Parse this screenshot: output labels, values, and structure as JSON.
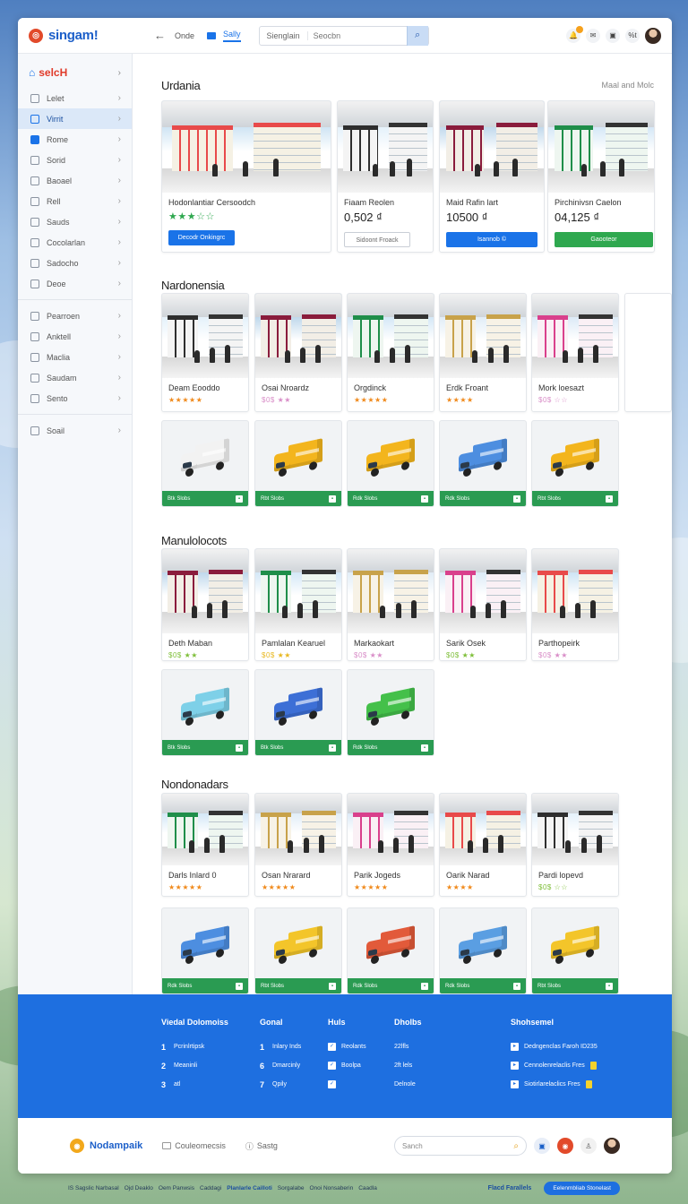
{
  "app": {
    "logo_text": "singam!"
  },
  "header": {
    "nav": [
      "Onde",
      "Sally",
      "Sienglain"
    ],
    "search_placeholder": "Seocbn",
    "icons": [
      "bell-icon",
      "chat-icon",
      "message-icon",
      "user-icon"
    ],
    "user_short": "%t"
  },
  "sidebar": {
    "head": "selcH",
    "items": [
      {
        "label": "Lelet",
        "icon": "document-icon"
      },
      {
        "label": "Virrit",
        "icon": "search-icon",
        "active": true
      },
      {
        "label": "Rome",
        "icon": "screen-icon"
      },
      {
        "label": "Sorid",
        "icon": "grid-icon"
      },
      {
        "label": "Baoael",
        "icon": "bag-icon"
      },
      {
        "label": "Rell",
        "icon": "folder-icon"
      },
      {
        "label": "Sauds",
        "icon": "table-icon"
      },
      {
        "label": "Cocolarlan",
        "icon": "clipboard-icon"
      },
      {
        "label": "Sadocho",
        "icon": "pin-icon"
      },
      {
        "label": "Deoe",
        "icon": "box-icon"
      }
    ],
    "items2": [
      {
        "label": "Pearroen",
        "icon": "settings-icon"
      },
      {
        "label": "Anktell",
        "icon": "square-icon"
      },
      {
        "label": "Maclia",
        "icon": "gear-icon"
      },
      {
        "label": "Saudam",
        "icon": "bag-icon"
      },
      {
        "label": "Sento",
        "icon": "square-icon"
      }
    ],
    "items3": [
      {
        "label": "Soail",
        "icon": "briefcase-icon"
      }
    ]
  },
  "sections": [
    {
      "title": "Urdania",
      "more": "Maal and Molc",
      "featured": [
        {
          "title": "Hodonlantiar Cersoodch",
          "stars": "★★★☆☆",
          "button": "Decodr Onkingrc",
          "button_style": "blue"
        },
        {
          "title": "Fiaam Reolen",
          "price": "0,502 ₫",
          "button": "Sidoont Froack",
          "button_style": "outline"
        },
        {
          "title": "Maid Rafin lart",
          "price": "10500 ₫",
          "button": "Isannob ©",
          "button_style": "blue-wide"
        },
        {
          "title": "Pirchinivsn Caelon",
          "price": "04,125 ₫",
          "button": "Gaooteor",
          "button_style": "green"
        }
      ]
    },
    {
      "title": "Nardonensia",
      "stores": [
        {
          "title": "Deam Eooddo",
          "stars": "★★★★★",
          "star_color": "#f08a1c"
        },
        {
          "title": "Osai Nroardz",
          "stars": "$0$ ★★",
          "star_color": "#d98ec8"
        },
        {
          "title": "Orgdinck",
          "stars": "★★★★★",
          "star_color": "#f08a1c"
        },
        {
          "title": "Erdk Froant",
          "stars": "★★★★",
          "star_color": "#f08a1c"
        },
        {
          "title": "Mork loesazt",
          "stars": "$0$ ☆☆",
          "star_color": "#d98ec8"
        }
      ],
      "trucks": [
        {
          "label": "Btk Slobs",
          "color": "#f2f2f2"
        },
        {
          "label": "Rbt Slobs",
          "color": "#f3b51d"
        },
        {
          "label": "Rdk Slobs",
          "color": "#f3b51d"
        },
        {
          "label": "Rdk Slobs",
          "color": "#4d8ee0"
        },
        {
          "label": "Rbt Slobs",
          "color": "#f3b51d"
        }
      ]
    },
    {
      "title": "Manulolocots",
      "stores": [
        {
          "title": "Deth Maban",
          "stars": "$0$ ★★",
          "star_color": "#7fbf3a"
        },
        {
          "title": "Pamlalan Kearuel",
          "stars": "$0$ ★★",
          "star_color": "#e8b820"
        },
        {
          "title": "Markaokart",
          "stars": "$0$ ★★",
          "star_color": "#d98ec8"
        },
        {
          "title": "Sarik Osek",
          "stars": "$0$ ★★",
          "star_color": "#7fbf3a"
        },
        {
          "title": "Parthopeirk",
          "stars": "$0$ ★★",
          "star_color": "#d98ec8"
        }
      ],
      "trucks": [
        {
          "label": "Btk Slobs",
          "color": "#7ed0e8"
        },
        {
          "label": "Btk Slobs",
          "color": "#3d6fd6"
        },
        {
          "label": "Rdk Slobs",
          "color": "#44c04a"
        }
      ]
    },
    {
      "title": "Nondonadars",
      "stores": [
        {
          "title": "Darls Inlard 0",
          "stars": "★★★★★",
          "star_color": "#f08a1c"
        },
        {
          "title": "Osan Nrarard",
          "stars": "★★★★★",
          "star_color": "#f08a1c"
        },
        {
          "title": "Parik Jogeds",
          "stars": "★★★★★",
          "star_color": "#f08a1c"
        },
        {
          "title": "Oarik Narad",
          "stars": "★★★★",
          "star_color": "#f08a1c"
        },
        {
          "title": "Pardi lopevd",
          "stars": "$0$ ☆☆",
          "star_color": "#7fbf3a"
        }
      ],
      "trucks": [
        {
          "label": "Rdk Slobs",
          "color": "#4d8ee0"
        },
        {
          "label": "Rbt Slobs",
          "color": "#f3c52a"
        },
        {
          "label": "Rdk Slobs",
          "color": "#e25a3a"
        },
        {
          "label": "Rdk Slobs",
          "color": "#5a9ee2"
        },
        {
          "label": "Rbt Slobs",
          "color": "#f3c52a"
        }
      ]
    }
  ],
  "footer": {
    "cols": [
      {
        "head": "Viedal Dolomoiss",
        "rows": [
          {
            "n": "1",
            "t": "Pcrinlrtipsk"
          },
          {
            "n": "2",
            "t": "Meaninli"
          },
          {
            "n": "3",
            "t": "atl"
          }
        ]
      },
      {
        "head": "Gonal",
        "rows": [
          {
            "n": "1",
            "t": "Inlary Inds"
          },
          {
            "n": "6",
            "t": "Dmarcinly"
          },
          {
            "n": "7",
            "t": "Qpily"
          }
        ]
      },
      {
        "head": "Huls",
        "rows": [
          {
            "t": "Reolants"
          },
          {
            "t": "Boolpa"
          },
          {
            "t": ""
          }
        ]
      },
      {
        "head": "Dholbs",
        "rows": [
          {
            "t": "22lfls"
          },
          {
            "t": "2ft lels"
          },
          {
            "t": "Delnole"
          }
        ]
      },
      {
        "head": "Shohsemel",
        "rows": [
          {
            "t": "Dedngenclas  Faroh ID235"
          },
          {
            "t": "Cennolenrelaclis  Fres"
          },
          {
            "t": "Siotirlarelaclics  Fres"
          }
        ]
      }
    ],
    "brand": "Nodampaik",
    "link1": "Couleomecsis",
    "link2": "Sastg",
    "search_placeholder": "Sanch",
    "strip": [
      "IS Sagslic Narbasal",
      "Ojd Deaklo",
      "Oem Panwsis",
      "Caddagi",
      "Planlarle Cailloti",
      "Sorgalabe",
      "Onoi Nonsaberin",
      "Caadla"
    ],
    "strip_label": "Flacd Farallels",
    "strip_pill": "Eelenmbliab Stonelast"
  }
}
